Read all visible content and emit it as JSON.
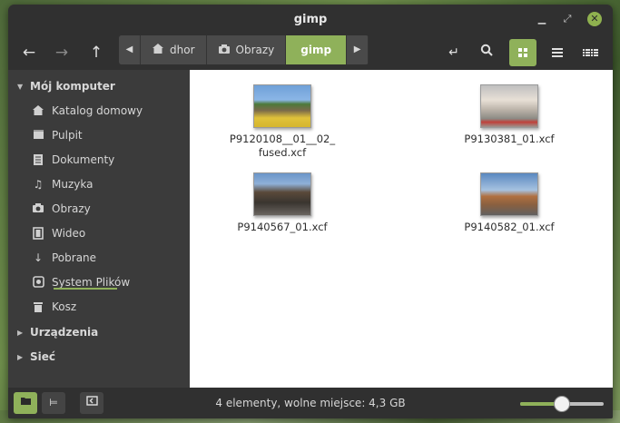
{
  "window": {
    "title": "gimp"
  },
  "breadcrumb": {
    "items": [
      {
        "label": "dhor",
        "icon": "home-icon"
      },
      {
        "label": "Obrazy",
        "icon": "camera-icon"
      },
      {
        "label": "gimp",
        "icon": ""
      }
    ]
  },
  "sidebar": {
    "sections": {
      "computer": "Mój komputer",
      "devices": "Urządzenia",
      "network": "Sieć"
    },
    "items": [
      {
        "label": "Katalog domowy",
        "icon": "home-icon"
      },
      {
        "label": "Pulpit",
        "icon": "desktop-icon"
      },
      {
        "label": "Dokumenty",
        "icon": "documents-icon"
      },
      {
        "label": "Muzyka",
        "icon": "music-icon"
      },
      {
        "label": "Obrazy",
        "icon": "camera-icon"
      },
      {
        "label": "Wideo",
        "icon": "video-icon"
      },
      {
        "label": "Pobrane",
        "icon": "download-icon"
      },
      {
        "label": "System Plików",
        "icon": "filesystem-icon"
      },
      {
        "label": "Kosz",
        "icon": "trash-icon"
      }
    ]
  },
  "files": [
    {
      "line1": "P9120108__01__02_",
      "line2": "fused.xcf"
    },
    {
      "line1": "P9130381_01.xcf",
      "line2": ""
    },
    {
      "line1": "P9140567_01.xcf",
      "line2": ""
    },
    {
      "line1": "P9140582_01.xcf",
      "line2": ""
    }
  ],
  "status": {
    "text": "4 elementy, wolne miejsce: 4,3 GB",
    "zoom_fraction": 0.5
  },
  "colors": {
    "accent": "#8fb15a"
  }
}
